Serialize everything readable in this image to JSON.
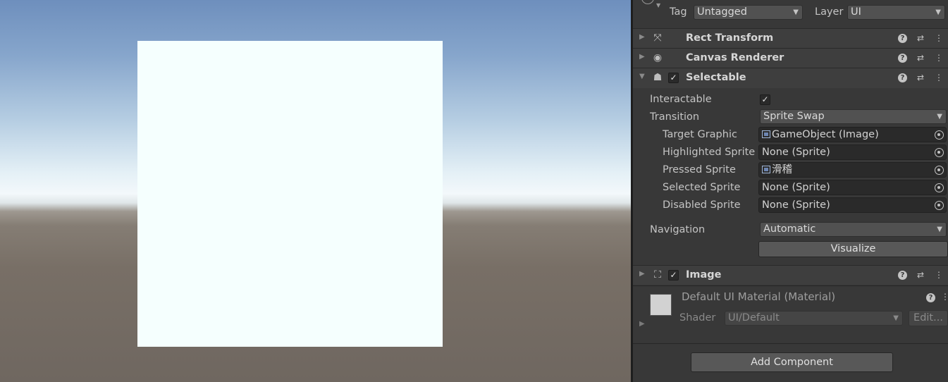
{
  "scene": {},
  "inspector": {
    "tag_label": "Tag",
    "tag_value": "Untagged",
    "layer_label": "Layer",
    "layer_value": "UI",
    "components": {
      "rect_transform": "Rect Transform",
      "canvas_renderer": "Canvas Renderer",
      "selectable": "Selectable",
      "image": "Image"
    },
    "selectable": {
      "interactable_label": "Interactable",
      "interactable_checked": true,
      "transition_label": "Transition",
      "transition_value": "Sprite Swap",
      "target_graphic_label": "Target Graphic",
      "target_graphic_value": "GameObject (Image)",
      "highlighted_label": "Highlighted Sprite",
      "highlighted_value": "None (Sprite)",
      "pressed_label": "Pressed Sprite",
      "pressed_value": "滑稽",
      "selected_label": "Selected Sprite",
      "selected_value": "None (Sprite)",
      "disabled_label": "Disabled Sprite",
      "disabled_value": "None (Sprite)",
      "navigation_label": "Navigation",
      "navigation_value": "Automatic",
      "visualize_label": "Visualize"
    },
    "material": {
      "name": "Default UI Material (Material)",
      "shader_label": "Shader",
      "shader_value": "UI/Default",
      "edit_label": "Edit..."
    },
    "add_component_label": "Add Component",
    "colors": {
      "panel_bg": "#383838",
      "header_bg": "#3e3e3e",
      "field_bg": "#2a2a2a",
      "image_tint": "#f5fffe"
    }
  }
}
